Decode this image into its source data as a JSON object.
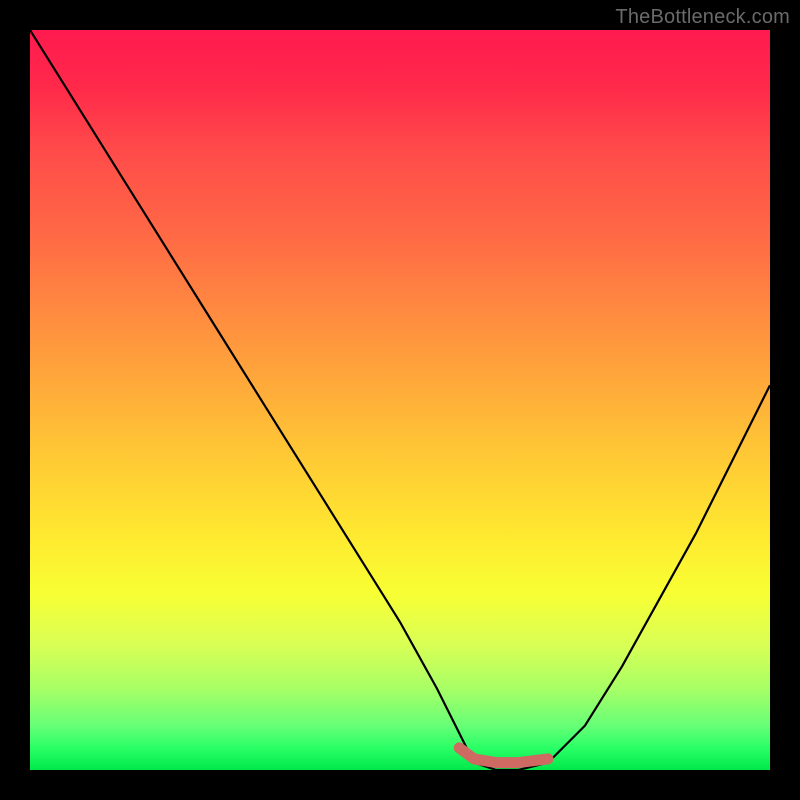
{
  "watermark": "TheBottleneck.com",
  "chart_data": {
    "type": "line",
    "title": "",
    "xlabel": "",
    "ylabel": "",
    "xlim": [
      0,
      100
    ],
    "ylim": [
      0,
      100
    ],
    "grid": false,
    "series": [
      {
        "name": "bottleneck-curve",
        "x": [
          0,
          5,
          10,
          15,
          20,
          25,
          30,
          35,
          40,
          45,
          50,
          55,
          58,
          60,
          63,
          66,
          70,
          75,
          80,
          85,
          90,
          95,
          100
        ],
        "values": [
          100,
          92,
          84,
          76,
          68,
          60,
          52,
          44,
          36,
          28,
          20,
          11,
          5,
          1,
          0,
          0,
          1,
          6,
          14,
          23,
          32,
          42,
          52
        ]
      },
      {
        "name": "optimal-range-marker",
        "x": [
          58,
          60,
          63,
          66,
          70
        ],
        "values": [
          3,
          1.5,
          1,
          1,
          1.5
        ]
      }
    ],
    "colors": {
      "curve": "#000000",
      "marker": "#cf6a63",
      "gradient_top": "#ff1a4f",
      "gradient_bottom": "#00e84a"
    }
  }
}
